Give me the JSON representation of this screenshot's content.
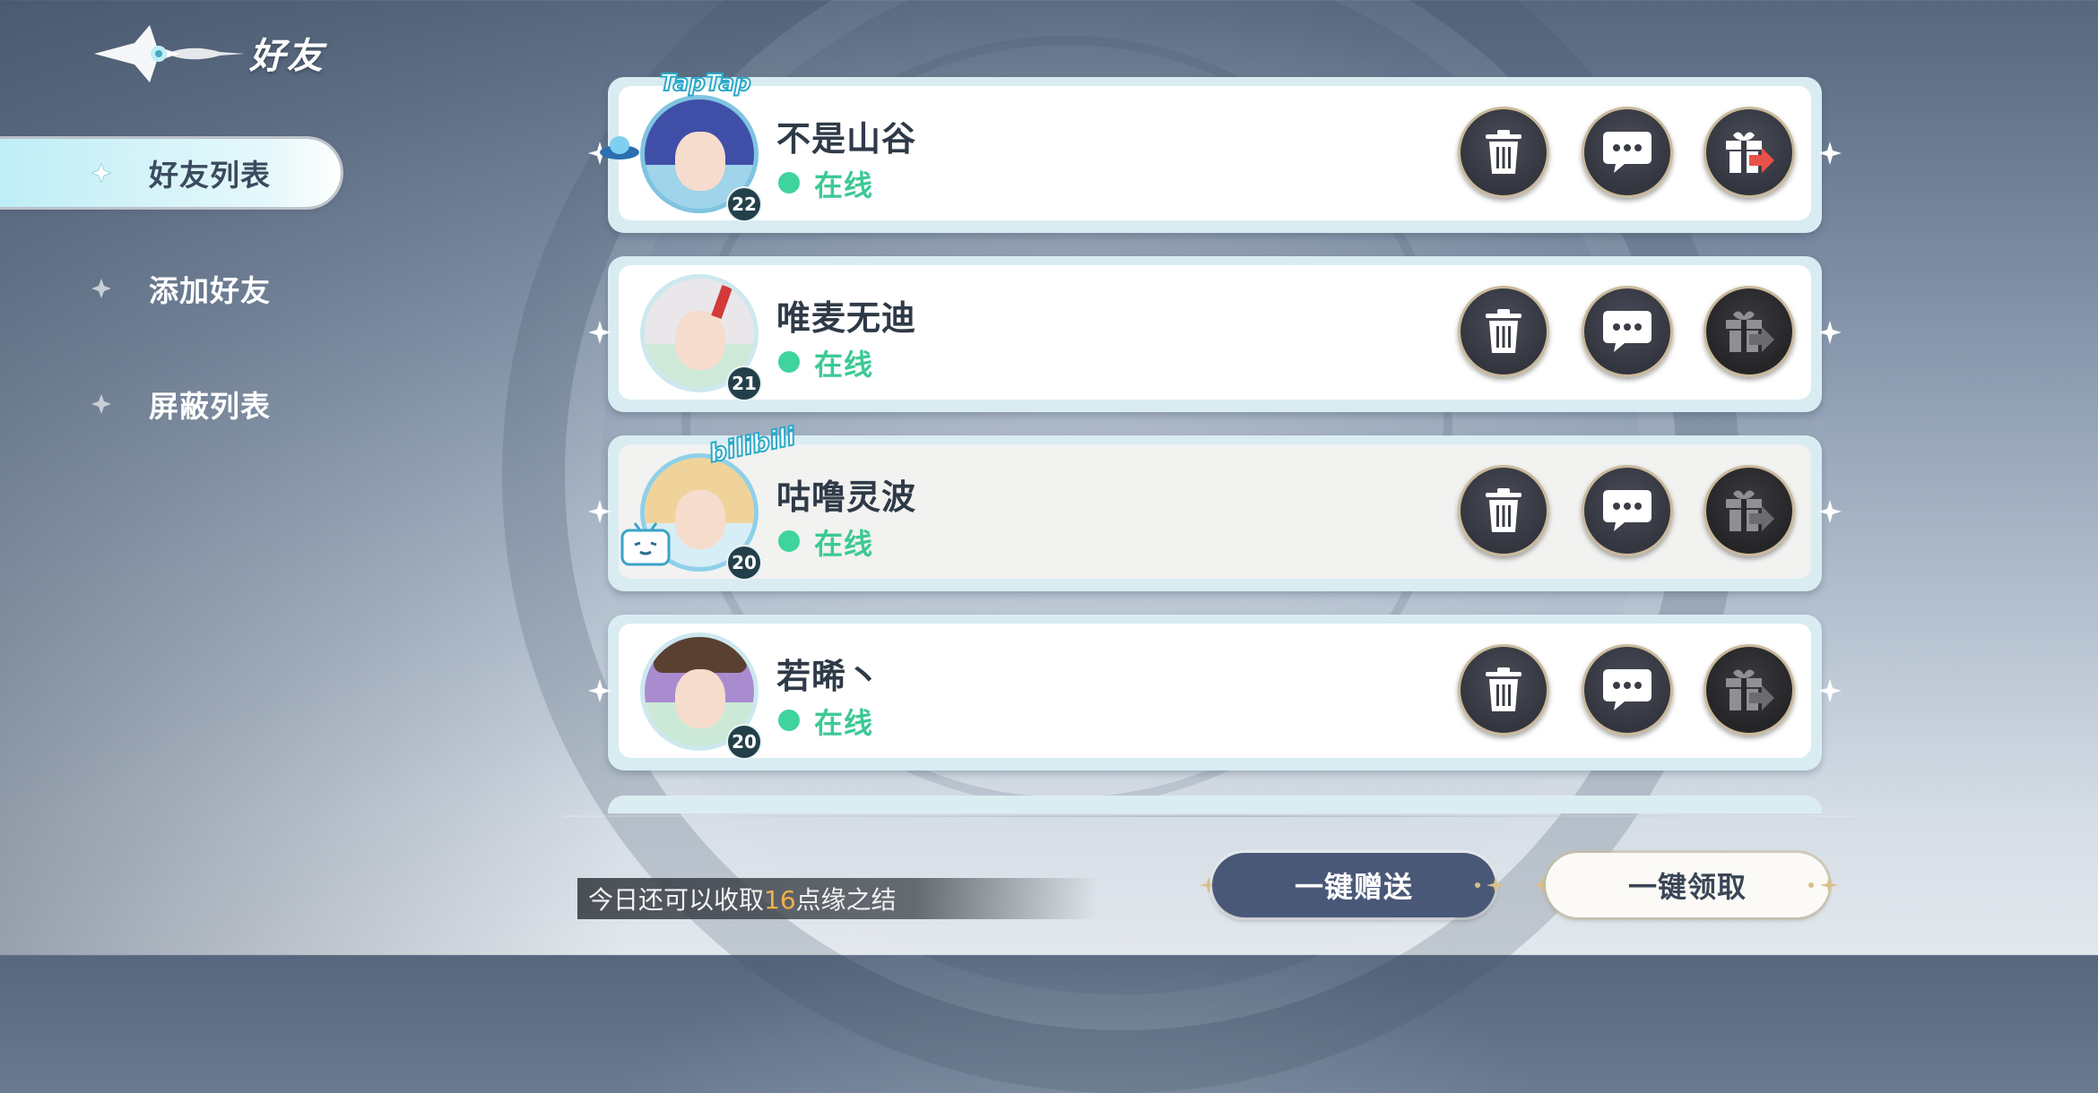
{
  "header": {
    "title": "好友",
    "logo_icon": "winged-emblem-icon"
  },
  "sidebar": {
    "items": [
      {
        "label": "好友列表",
        "active": true
      },
      {
        "label": "添加好友",
        "active": false
      },
      {
        "label": "屏蔽列表",
        "active": false
      }
    ]
  },
  "friends": [
    {
      "name": "不是山谷",
      "status": "在线",
      "level": "22",
      "frame_tag": "TapTap",
      "gift_available": true
    },
    {
      "name": "唯麦无迪",
      "status": "在线",
      "level": "21",
      "frame_tag": "",
      "gift_available": false
    },
    {
      "name": "咕噜灵波",
      "status": "在线",
      "level": "20",
      "frame_tag": "bilibili",
      "gift_available": false
    },
    {
      "name": "若晞丶",
      "status": "在线",
      "level": "20",
      "frame_tag": "",
      "gift_available": false
    }
  ],
  "actions": {
    "delete_icon": "trash-icon",
    "chat_icon": "chat-bubble-icon",
    "gift_icon": "gift-send-icon"
  },
  "footer": {
    "today_prefix": "今日还可以收取",
    "today_count": "16",
    "today_suffix": "点缘之结",
    "send_all_label": "一键赠送",
    "claim_all_label": "一键领取"
  },
  "colors": {
    "online": "#3cc995",
    "gift_active_arrow": "#e8524a",
    "send_button": "#4a5878",
    "counter_highlight": "#f0b14a"
  }
}
